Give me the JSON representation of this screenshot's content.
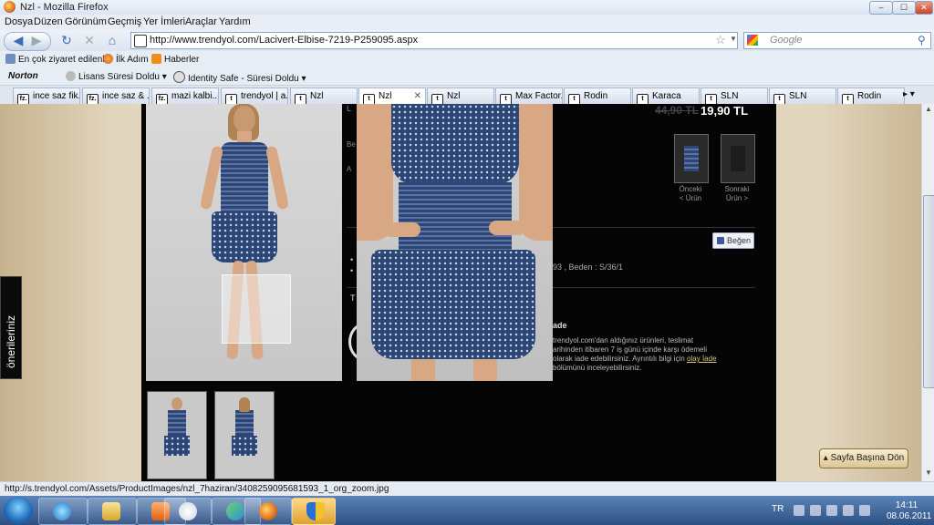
{
  "window": {
    "title": "Nzl - Mozilla Firefox",
    "btn_min": "–",
    "btn_max": "☐",
    "btn_close": "✕"
  },
  "menu": [
    "Dosya",
    "Düzen",
    "Görünüm",
    "Geçmiş",
    "Yer İmleri",
    "Araçlar",
    "Yardım"
  ],
  "nav": {
    "url": "http://www.trendyol.com/Lacivert-Elbise-7219-P259095.aspx",
    "search_placeholder": "Google",
    "back_icon": "back-arrow-icon",
    "forward_icon": "forward-arrow-icon",
    "reload_icon": "reload-icon",
    "stop_icon": "stop-icon",
    "home_icon": "home-icon"
  },
  "bookmarks": [
    "En çok ziyaret edilenler",
    "İlk Adım",
    "Haberler"
  ],
  "norton": {
    "logo": "Norton",
    "license": "Lisans Süresi Doldu",
    "identity": "Identity Safe - Süresi Doldu"
  },
  "tabs": [
    {
      "label": "ince saz fik...",
      "icon": "fz."
    },
    {
      "label": "ince saz & ...",
      "icon": "fz."
    },
    {
      "label": "mazi kalbi...",
      "icon": "fz."
    },
    {
      "label": "trendyol | a...",
      "icon": "t"
    },
    {
      "label": "Nzl",
      "icon": "t"
    },
    {
      "label": "Nzl",
      "icon": "t",
      "active": true
    },
    {
      "label": "Nzl",
      "icon": "t"
    },
    {
      "label": "Max Factor...",
      "icon": "t"
    },
    {
      "label": "Rodin",
      "icon": "t"
    },
    {
      "label": "Karaca",
      "icon": "t"
    },
    {
      "label": "SLN",
      "icon": "t"
    },
    {
      "label": "SLN",
      "icon": "t"
    },
    {
      "label": "Rodin",
      "icon": "t"
    }
  ],
  "product": {
    "price_old": "44,90 TL",
    "price_new": "19,90 TL",
    "prev_label": "Önceki\n< Ürün",
    "next_label": "Sonraki\nÜrün >",
    "like": "Beğen",
    "size_text": "93 , Beden : S/36/1",
    "iade_title": "ade",
    "iade_text": "trendyol.com'dan aldığınız ürünleri, teslimat arihinden itibaren 7 iş günü içinde karşı ödemeli olarak iade edebilirsiniz. Ayrıntılı bilgi için",
    "iade_link": "olay İade",
    "iade_tail": " bölümünü inceleyebilirsiniz.",
    "cut_L": "L",
    "cut_Be": "Be",
    "cut_A": "A",
    "cut_T": "T"
  },
  "side_tab": "önerileriniz",
  "top_button": "Sayfa Başına Dön",
  "status": "http://s.trendyol.com/Assets/ProductImages/nzl_7haziran/3408259095681593_1_org_zoom.jpg",
  "taskbar": {
    "lang": "TR",
    "time": "14:11",
    "date": "08.06.2011",
    "items": [
      "ie-icon",
      "explorer-icon",
      "media-player-icon",
      "hp-icon",
      "messenger-icon",
      "firefox-icon",
      "security-shield-icon"
    ]
  },
  "colors": {
    "dark_panel": "#050505",
    "accent_gold": "#dcc592",
    "taskbar": "#2c4f83"
  }
}
